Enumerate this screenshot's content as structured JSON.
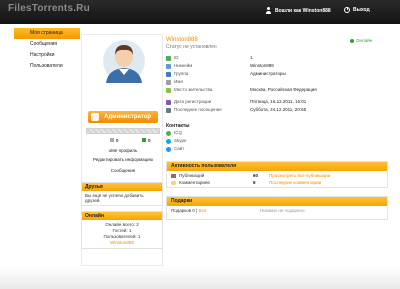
{
  "header": {
    "logo": "FilesTorrents.Ru",
    "user_text": "Вошли как Winston888",
    "logout_label": "Выход"
  },
  "sidebar": {
    "items": [
      {
        "label": "Моя страница",
        "active": true
      },
      {
        "label": "Сообщения",
        "active": false
      },
      {
        "label": "Настройки",
        "active": false
      },
      {
        "label": "Пользователи",
        "active": false
      }
    ]
  },
  "profile": {
    "name": "Winston888",
    "status": "Статус не установлен",
    "online_label": "Онлайн",
    "role_button": "Администратор",
    "count_left": "0",
    "count_right": "0",
    "links": [
      "uMe профиль",
      "Редактировать информацию",
      "Сообщения"
    ],
    "info": [
      {
        "label": "ID",
        "value": "1",
        "icon": "id-icon"
      },
      {
        "label": "Никнейм",
        "value": "Winston888",
        "icon": "nickname-icon"
      },
      {
        "label": "Группа",
        "value": "Администраторы",
        "icon": "group-icon"
      },
      {
        "label": "Имя",
        "value": "",
        "icon": "name-icon"
      },
      {
        "label": "Место жительства",
        "value": "Москва, Российская Федерация",
        "icon": "location-icon"
      },
      {
        "label": "Дата регистрации",
        "value": "Пятница, 16.12.2011, 15:01",
        "icon": "calendar-icon"
      },
      {
        "label": "Последнее посещение",
        "value": "Суббота, 24.12.2011, 20:55",
        "icon": "clock-icon"
      }
    ],
    "contacts_title": "Контакты",
    "contacts": [
      {
        "label": "ICQ",
        "icon": "icq-icon"
      },
      {
        "label": "Skype",
        "icon": "skype-icon"
      },
      {
        "label": "Сайт",
        "icon": "site-icon"
      }
    ]
  },
  "friends": {
    "title": "Друзья",
    "text": "Вы ещё не успели добавить друзей."
  },
  "online": {
    "title": "Онлайн",
    "total": "Онлайн всего: 2",
    "guests": "Гостей: 1",
    "users": "Пользователей: 1",
    "user": "Winston888"
  },
  "activity": {
    "title": "Активность пользователя",
    "rows": [
      {
        "label": "Публикаций",
        "count": "60",
        "link": "Просмотреть все публикации",
        "icon": "publications-icon"
      },
      {
        "label": "Комментариев",
        "count": "8",
        "link": "Последние комментарии",
        "icon": "comments-icon"
      }
    ]
  },
  "gifts": {
    "title": "Подарки",
    "count_text": "Подарков 0 |",
    "all_link": "Все",
    "empty_text": "Никаких не подарено."
  },
  "colors": {
    "accent": "#f39a00",
    "header_bg": "#1e1e1e",
    "link": "#f08c00",
    "online": "#2aa52a"
  }
}
